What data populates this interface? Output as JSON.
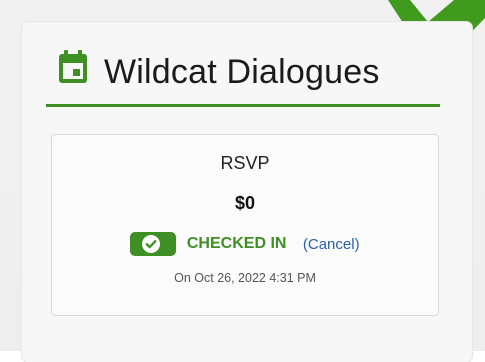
{
  "event": {
    "title": "Wildcat Dialogues"
  },
  "rsvp": {
    "heading": "RSVP",
    "price": "$0",
    "status": "CHECKED IN",
    "cancel_label": "(Cancel)",
    "timestamp": "On Oct 26, 2022 4:31 PM"
  },
  "colors": {
    "accent_green": "#3f8f24",
    "link_blue": "#2a62a6"
  },
  "icons": {
    "title_icon": "calendar-icon",
    "status_icon": "check-circle-icon",
    "corner_icon": "checkmark-icon"
  }
}
